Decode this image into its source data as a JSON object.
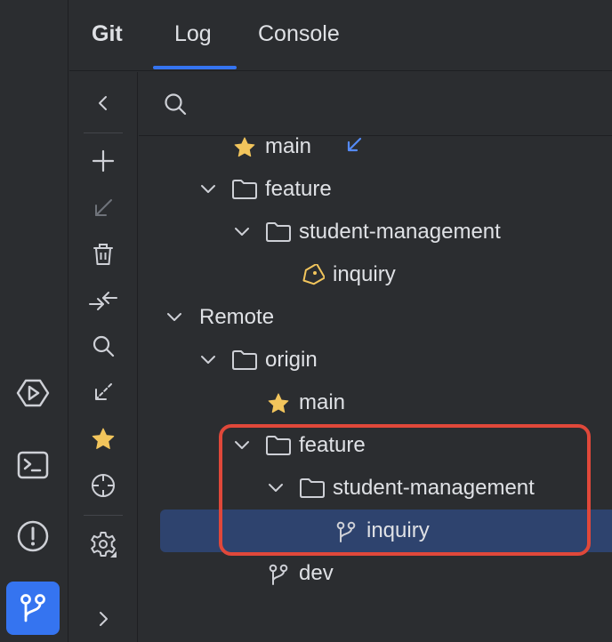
{
  "header": {
    "tool_title": "Git",
    "tabs": [
      {
        "label": "Log",
        "active": true
      },
      {
        "label": "Console",
        "active": false
      }
    ]
  },
  "toolbar": {
    "icons": [
      "chevron-left-icon",
      "plus-icon",
      "checkout-arrow-icon",
      "trash-icon",
      "compare-arrows-icon",
      "search-icon",
      "update-arrow-icon",
      "star-icon",
      "crosshair-icon",
      "gear-icon",
      "chevron-right-icon"
    ]
  },
  "activity_bar": {
    "icons": [
      "services-icon",
      "terminal-icon",
      "problems-icon",
      "git-branch-icon"
    ],
    "active": "git-branch-icon"
  },
  "tree": {
    "rows": [
      {
        "label": "main",
        "icon": "star-icon"
      },
      {
        "label": "feature",
        "icon": "folder-icon",
        "expanded": true
      },
      {
        "label": "student-management",
        "icon": "folder-icon",
        "expanded": true
      },
      {
        "label": "inquiry",
        "icon": "tag-icon"
      },
      {
        "label": "Remote",
        "expanded": true
      },
      {
        "label": "origin",
        "icon": "folder-icon",
        "expanded": true
      },
      {
        "label": "main",
        "icon": "star-icon"
      },
      {
        "label": "feature",
        "icon": "folder-icon",
        "expanded": true
      },
      {
        "label": "student-management",
        "icon": "folder-icon",
        "expanded": true
      },
      {
        "label": "inquiry",
        "icon": "branch-icon",
        "selected": true
      },
      {
        "label": "dev",
        "icon": "branch-icon"
      }
    ]
  },
  "colors": {
    "accent": "#3574f0",
    "selection": "#2e436e",
    "highlight_border": "#e0483a",
    "star": "#f2c55c",
    "incoming_arrow": "#548af7"
  }
}
